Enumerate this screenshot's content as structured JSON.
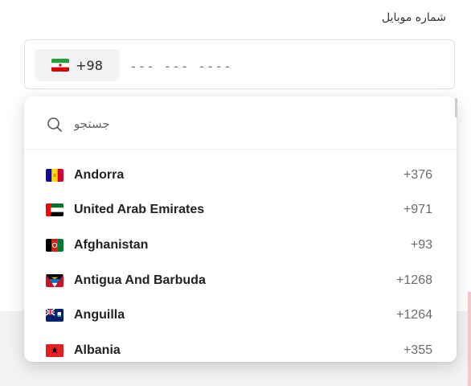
{
  "field": {
    "label": "شماره موبایل",
    "selected_code": "+98",
    "selected_flag": "iran-flag-icon",
    "phone_placeholder": "--- --- ----"
  },
  "dropdown": {
    "search_placeholder": "جستجو",
    "countries": [
      {
        "name": "Andorra",
        "code": "+376",
        "flag": "andorra-flag-icon"
      },
      {
        "name": "United Arab Emirates",
        "code": "+971",
        "flag": "uae-flag-icon"
      },
      {
        "name": "Afghanistan",
        "code": "+93",
        "flag": "afghanistan-flag-icon"
      },
      {
        "name": "Antigua And Barbuda",
        "code": "+1268",
        "flag": "antigua-flag-icon"
      },
      {
        "name": "Anguilla",
        "code": "+1264",
        "flag": "anguilla-flag-icon"
      },
      {
        "name": "Albania",
        "code": "+355",
        "flag": "albania-flag-icon"
      }
    ]
  }
}
